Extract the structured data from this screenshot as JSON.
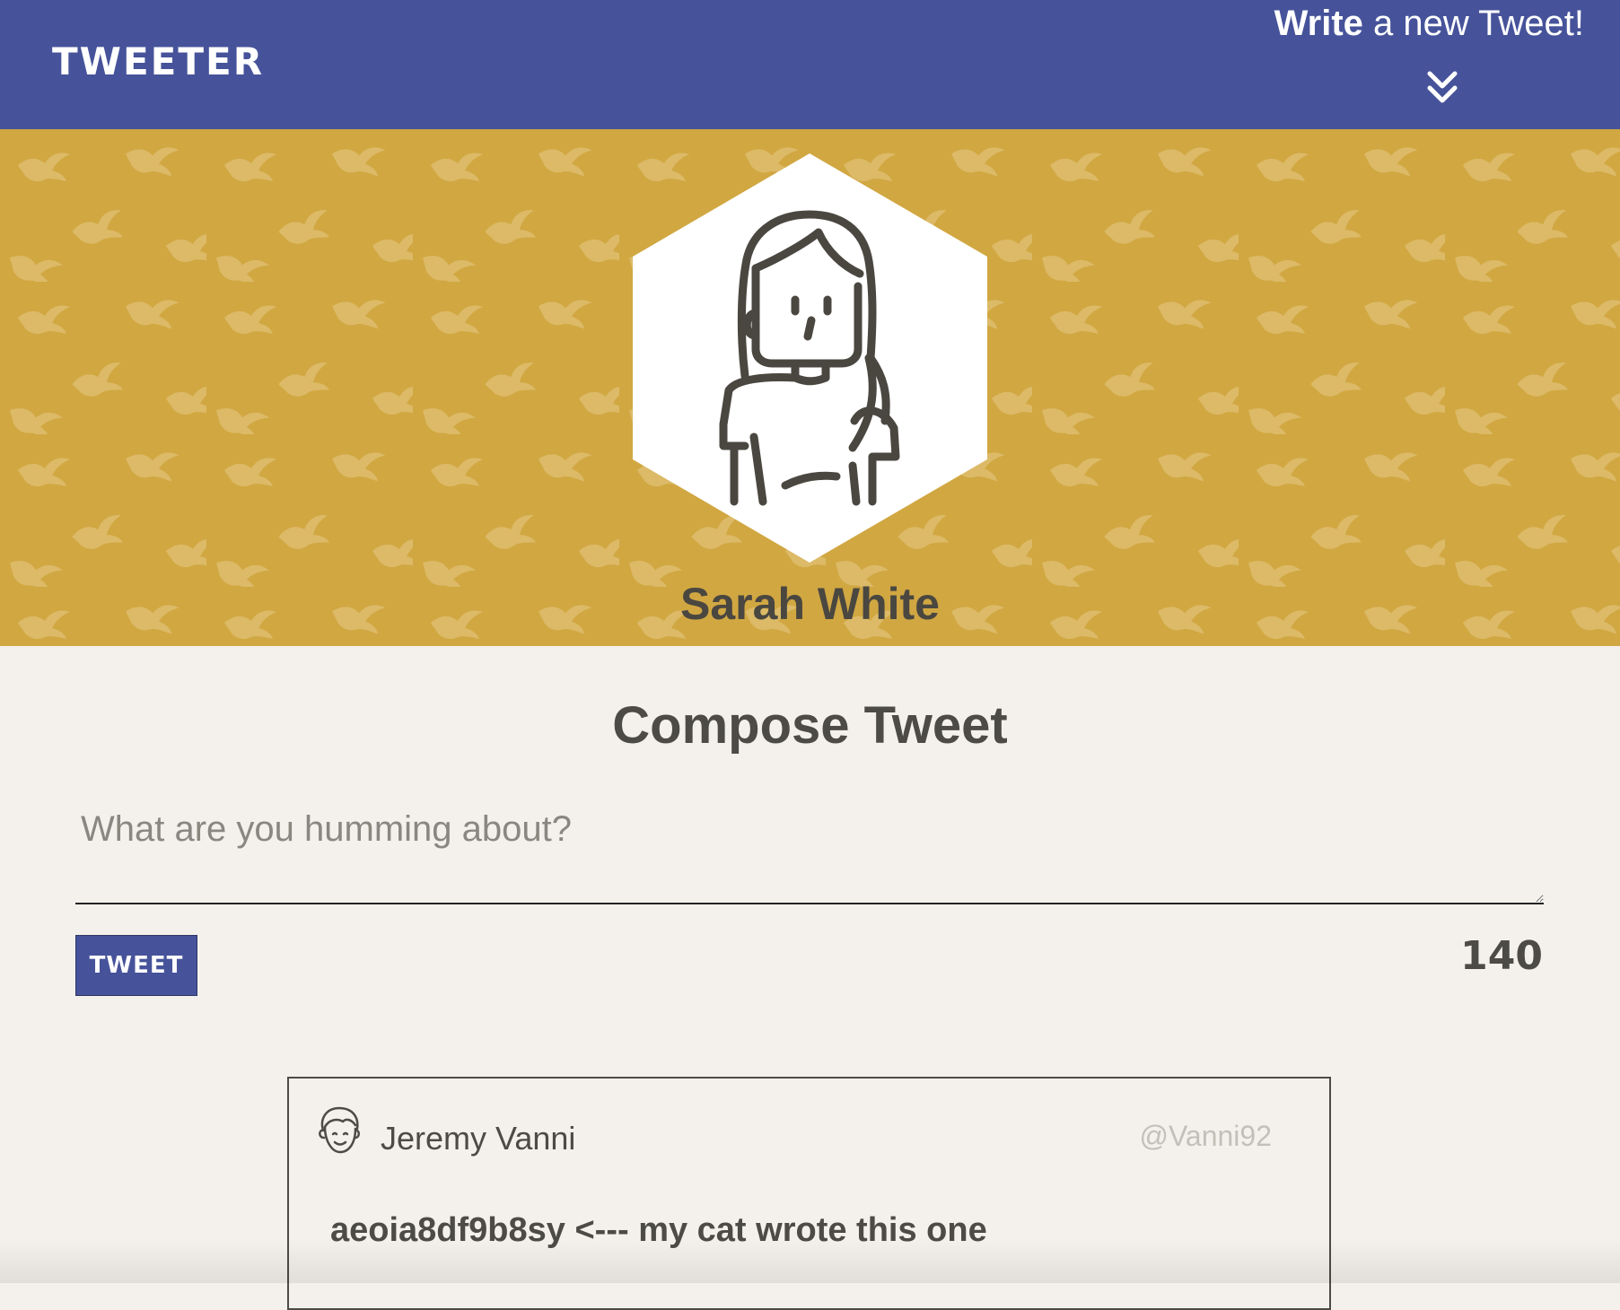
{
  "nav": {
    "brand": "TWEETER",
    "compose_toggle": {
      "bold_word": "Write",
      "rest": " a new Tweet!",
      "icon": "double-chevron-down-icon"
    }
  },
  "profile": {
    "name": "Sarah White",
    "avatar_icon": "woman-avatar-icon",
    "background_pattern_icon": "bird-icon"
  },
  "compose": {
    "title": "Compose Tweet",
    "placeholder": "What are you humming about?",
    "value": "",
    "button_label": "TWEET",
    "counter": "140"
  },
  "tweets": [
    {
      "avatar_icon": "man-avatar-icon",
      "name": "Jeremy Vanni",
      "handle": "@Vanni92",
      "content": "aeoia8df9b8sy <--- my cat wrote this one"
    }
  ],
  "colors": {
    "nav_bg": "#46539a",
    "header_bg": "#d1a742",
    "page_bg": "#f4f1ec",
    "text": "#4d4b45",
    "handle": "#c3c0b9"
  }
}
